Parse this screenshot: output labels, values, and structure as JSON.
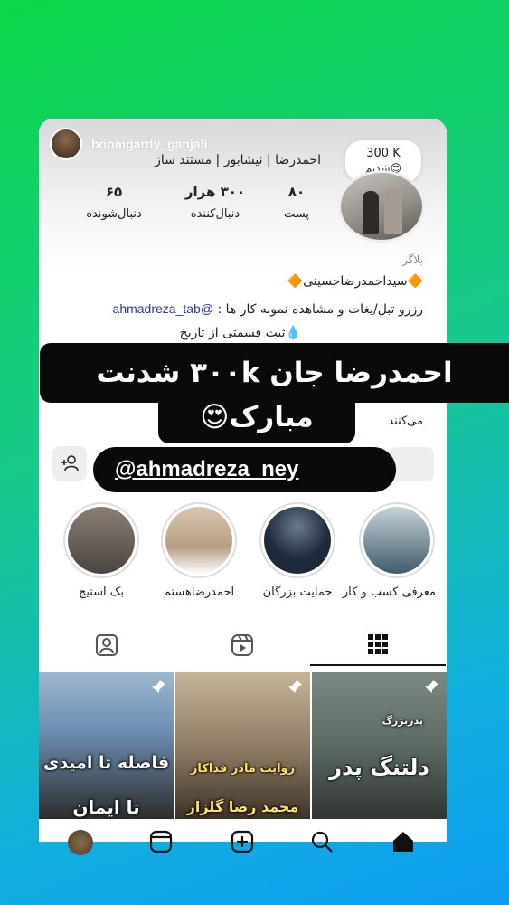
{
  "profile": {
    "username": "boomgardy_ganjali",
    "bio_line": "احمدرضا | نیشابور | مستند ساز",
    "badge": {
      "line1": "300 K",
      "line2": "شدیم😍"
    },
    "stats": {
      "posts": {
        "value": "۸۰",
        "label": "پست"
      },
      "followers": {
        "value": "۳۰۰ هزار",
        "label": "دنبال‌کننده"
      },
      "following": {
        "value": "۶۵",
        "label": "دنبال‌شونده"
      }
    },
    "role": "بلاگر",
    "name_line": "سیداحمدرضاحسینی",
    "reserve_text": "رزرو تبل/یغات و مشاهده نمونه کار ها :",
    "reserve_handle": "@ahmadreza_tab",
    "register_text": "ثبت قسمتی از تاریخ",
    "bio_cont": "می‌کنند"
  },
  "stickers": {
    "banner_line1": "احمدرضا جان ۳۰۰k شدنت",
    "banner_line2": "مبارک😍",
    "handle": "@ahmadreza_ney"
  },
  "highlights": [
    {
      "label": "معرفی کسب و کار",
      "color": "#3f5b6a"
    },
    {
      "label": "حمایت بزرگان",
      "color": "#1e2a3c"
    },
    {
      "label": "احمدرضاهستم",
      "color": "#b89d84"
    },
    {
      "label": "بک استیج",
      "color": "#4a4440"
    }
  ],
  "tabs": [
    {
      "icon": "tagged-icon"
    },
    {
      "icon": "reels-icon"
    },
    {
      "icon": "grid-icon"
    }
  ],
  "posts": [
    {
      "text1": "فاصله تا امیدی",
      "text2": "تا ایمان",
      "color": "#6c8fb3"
    },
    {
      "text1": "روایت مادر فداکار",
      "text2": "محمد رضا گلزار",
      "color": "#8a7760"
    },
    {
      "text1": "پدربزرگ",
      "text2": "دلتنگ پدر",
      "color": "#5d6a63"
    }
  ],
  "nav": [
    "profile-avatar",
    "reels-icon",
    "create-icon",
    "search-icon",
    "home-icon"
  ]
}
